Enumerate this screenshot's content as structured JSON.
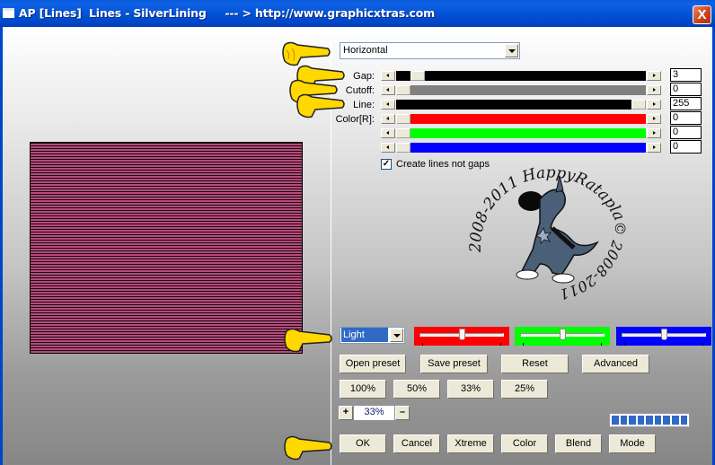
{
  "window": {
    "title": "AP [Lines]  Lines - SilverLining     --- > http://www.graphicxtras.com",
    "close_label": "X"
  },
  "preview": {
    "line_color": "#1a0a12",
    "fill_color": "#b64a7c"
  },
  "direction_select": {
    "value": "Horizontal"
  },
  "sliders": [
    {
      "name": "gap",
      "label": "Gap:",
      "value": "3",
      "track_color": "#000000",
      "position": 0.03
    },
    {
      "name": "cutoff",
      "label": "Cutoff:",
      "value": "0",
      "track_color": "#808080",
      "position": 0.0
    },
    {
      "name": "line",
      "label": "Line:",
      "value": "255",
      "track_color": "#000000",
      "position": 1.0
    },
    {
      "name": "color-r",
      "label": "Color[R]:",
      "value": "0",
      "track_color": "#ff0000",
      "position": 0.0
    },
    {
      "name": "color-g",
      "label": "",
      "value": "0",
      "track_color": "#00ff00",
      "position": 0.0
    },
    {
      "name": "color-b",
      "label": "",
      "value": "0",
      "track_color": "#0000ff",
      "position": 0.0
    }
  ],
  "checkbox": {
    "label": "Create lines not gaps",
    "checked": true
  },
  "logo": {
    "text_top": "© 2008-2011  HappyRataplan",
    "text_bottom": "HappyRataplan © 2008-2011",
    "top_arc": "2008-2011  HappyRataplan",
    "left_arc": "HappyRataplan ©",
    "bottom_arc": "© 2008-2011"
  },
  "mode_select": {
    "value": "Light"
  },
  "color_trackbars": [
    {
      "name": "red",
      "color": "#ff0000",
      "position": 0.5
    },
    {
      "name": "green",
      "color": "#00ff00",
      "position": 0.5
    },
    {
      "name": "blue",
      "color": "#0000ff",
      "position": 0.5
    }
  ],
  "buttons_row1": [
    "Open preset",
    "Save preset",
    "Reset",
    "Advanced"
  ],
  "buttons_zoom": [
    "100%",
    "50%",
    "33%",
    "25%"
  ],
  "zoom_control": {
    "plus": "+",
    "value": "33%",
    "minus": "–"
  },
  "progress": {
    "segments": 9
  },
  "buttons_bottom": [
    "OK",
    "Cancel",
    "Xtreme",
    "Color",
    "Blend",
    "Mode"
  ]
}
